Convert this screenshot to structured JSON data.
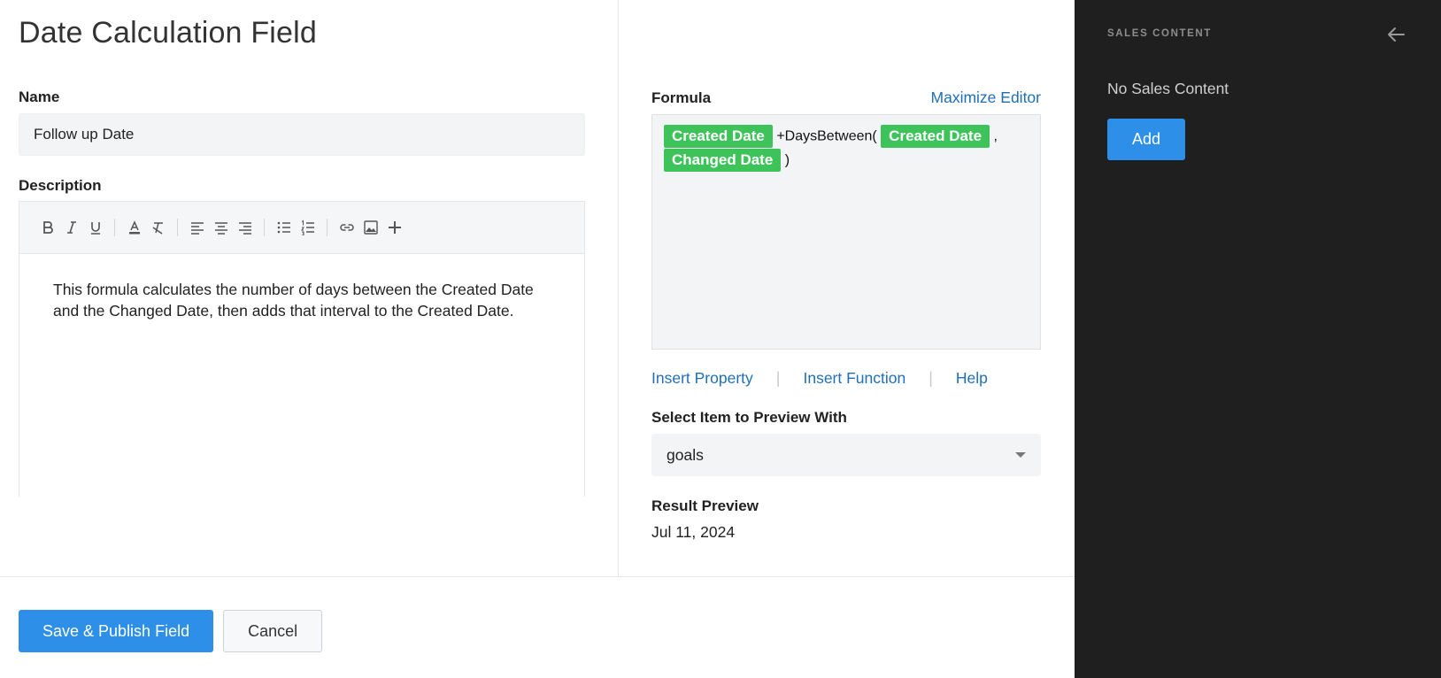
{
  "page": {
    "title": "Date Calculation Field"
  },
  "name_field": {
    "label": "Name",
    "value": "Follow up Date"
  },
  "description": {
    "label": "Description",
    "toolbar": [
      "bold-icon",
      "italic-icon",
      "underline-icon",
      "text-color-icon",
      "clear-format-icon",
      "align-left-icon",
      "align-center-icon",
      "align-right-icon",
      "bulleted-list-icon",
      "numbered-list-icon",
      "link-icon",
      "image-icon",
      "plus-icon"
    ],
    "body": "This formula calculates the number of days between the Created Date and the Changed Date, then adds that interval to the Created Date."
  },
  "formula": {
    "label": "Formula",
    "maximize_label": "Maximize Editor",
    "tokens": {
      "chip1": "Created Date",
      "text1": "+DaysBetween(",
      "chip2": "Created Date",
      "text2": ",",
      "chip3": "Changed Date",
      "text3": ")"
    },
    "chip_color": "#3ec35a"
  },
  "formula_links": {
    "insert_property": "Insert Property",
    "separator": "|",
    "insert_function": "Insert Function",
    "help": "Help"
  },
  "preview": {
    "label": "Select Item to Preview With",
    "selected": "goals"
  },
  "result": {
    "label": "Result Preview",
    "value": "Jul 11, 2024"
  },
  "footer": {
    "save_label": "Save & Publish Field",
    "cancel_label": "Cancel"
  },
  "sidebar": {
    "title": "SALES CONTENT",
    "empty_text": "No Sales Content",
    "add_label": "Add",
    "background": "#1f1f1f",
    "accent": "#2d8fe8"
  }
}
